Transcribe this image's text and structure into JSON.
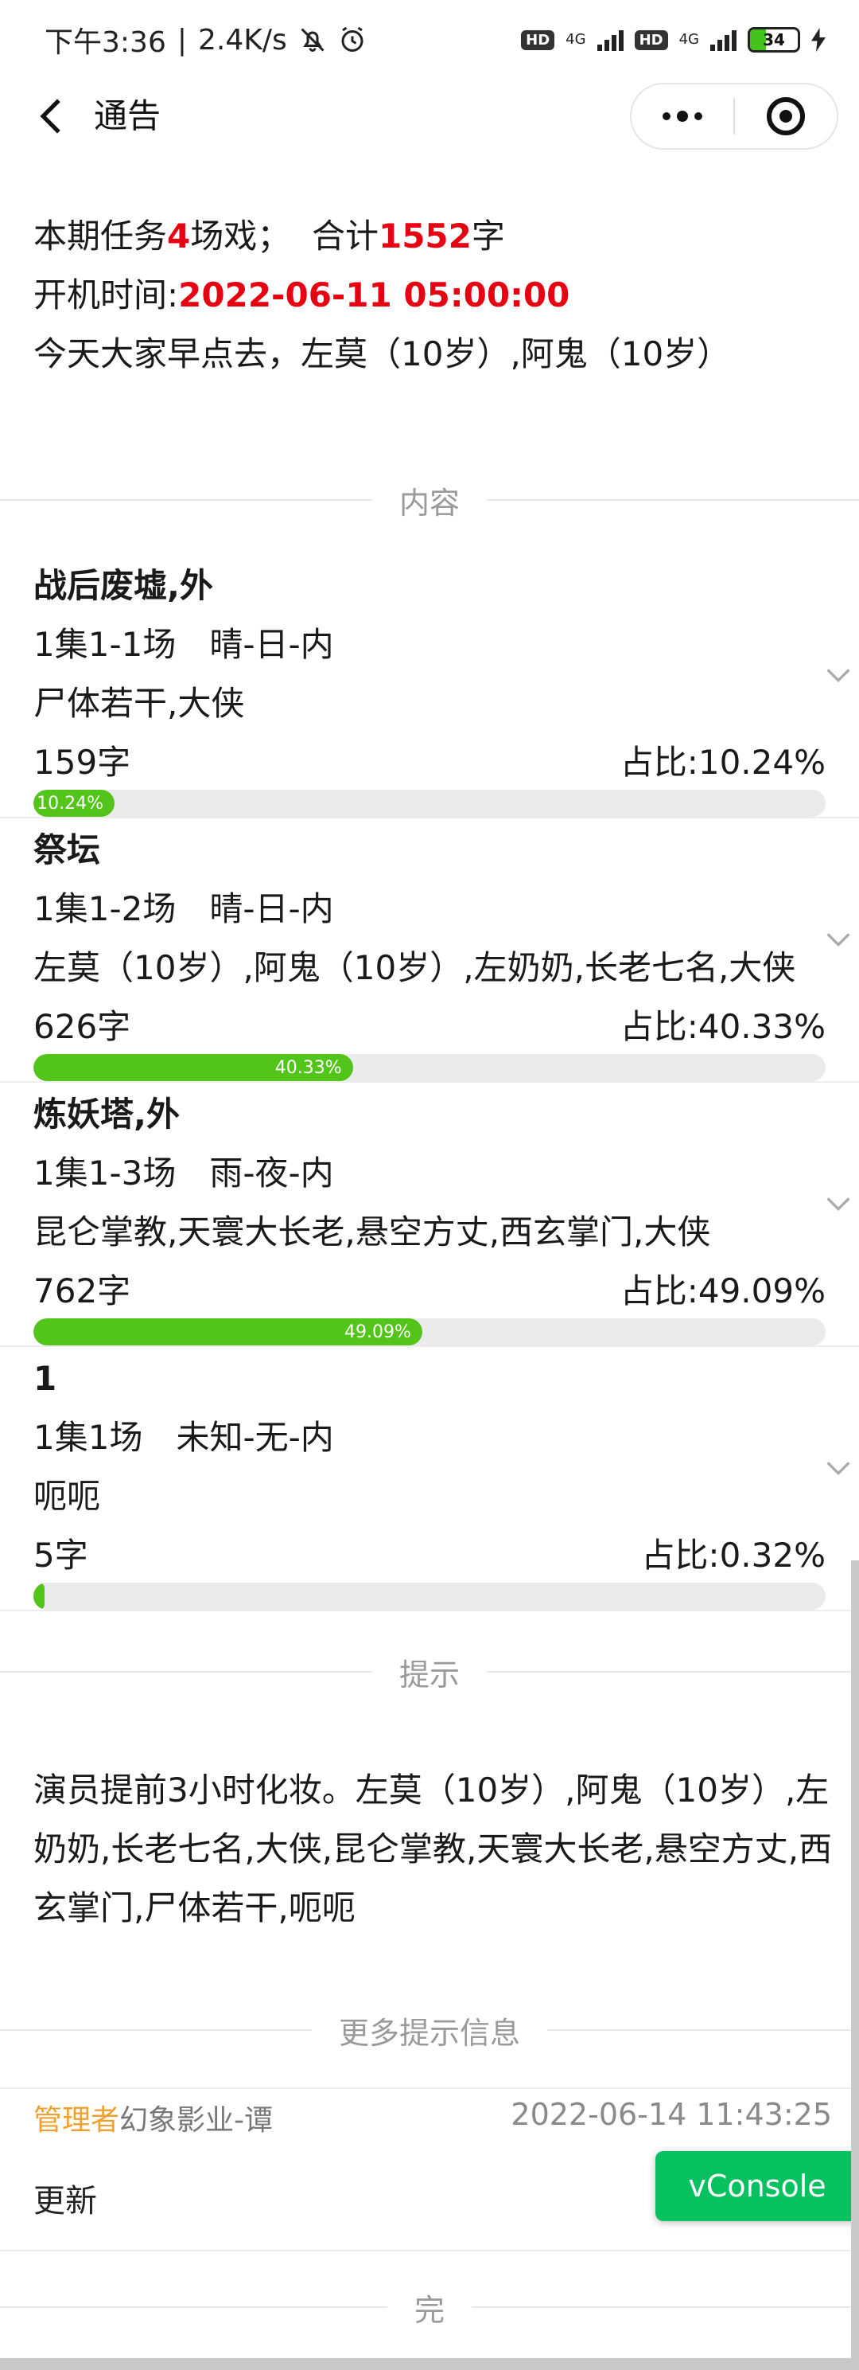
{
  "status_bar": {
    "time": "下午3:36",
    "speed": "2.4K/s",
    "hd1": "HD",
    "net1": "4G",
    "hd2": "HD",
    "net2": "4G",
    "battery": "34",
    "battery_level": 0.34,
    "battery_color": "#46c21e"
  },
  "nav": {
    "title": "通告",
    "back_icon": "chevron-left-icon",
    "more_icon": "more-dots-icon",
    "close_icon": "target-circle-icon"
  },
  "summary": {
    "task_prefix": "本期任务",
    "scene_count": "4",
    "scene_suffix": "场戏；",
    "total_prefix": "合计",
    "total_words": "1552",
    "total_suffix": "字",
    "start_label": "开机时间:",
    "start_time": "2022-06-11 05:00:00",
    "note": "今天大家早点去，左莫（10岁）,阿鬼（10岁）"
  },
  "sections": {
    "content": "内容",
    "tips": "提示",
    "more_tips": "更多提示信息",
    "end": "完"
  },
  "scenes": [
    {
      "title": "战后废墟,外",
      "scene": "1集1-1场　晴-日-内",
      "roles": "尸体若干,大侠",
      "words": "159字",
      "ratio": "占比:10.24%",
      "percent": 10.24,
      "bar_label": "10.24%"
    },
    {
      "title": "祭坛",
      "scene": "1集1-2场　晴-日-内",
      "roles": "左莫（10岁）,阿鬼（10岁）,左奶奶,长老七名,大侠",
      "words": "626字",
      "ratio": "占比:40.33%",
      "percent": 40.33,
      "bar_label": "40.33%"
    },
    {
      "title": "炼妖塔,外",
      "scene": "1集1-3场　雨-夜-内",
      "roles": "昆仑掌教,天寰大长老,悬空方丈,西玄掌门,大侠",
      "words": "762字",
      "ratio": "占比:49.09%",
      "percent": 49.09,
      "bar_label": "49.09%"
    },
    {
      "title": "1",
      "scene": "1集1场　未知-无-内",
      "roles": "呃呃",
      "words": "5字",
      "ratio": "占比:0.32%",
      "percent": 0.32,
      "bar_label": ""
    }
  ],
  "tips_text": "演员提前3小时化妆。左莫（10岁）,阿鬼（10岁）,左奶奶,长老七名,大侠,昆仑掌教,天寰大长老,悬空方丈,西玄掌门,尸体若干,呃呃",
  "update": {
    "role": "管理者",
    "name": "幻象影业-谭",
    "time": "2022-06-14 11:43:25",
    "text": "更新"
  },
  "vconsole_label": "vConsole",
  "colors": {
    "accent_red": "#e60012",
    "progress_green": "#52c41a",
    "admin_orange": "#f0a030",
    "vconsole_green": "#07c160"
  }
}
